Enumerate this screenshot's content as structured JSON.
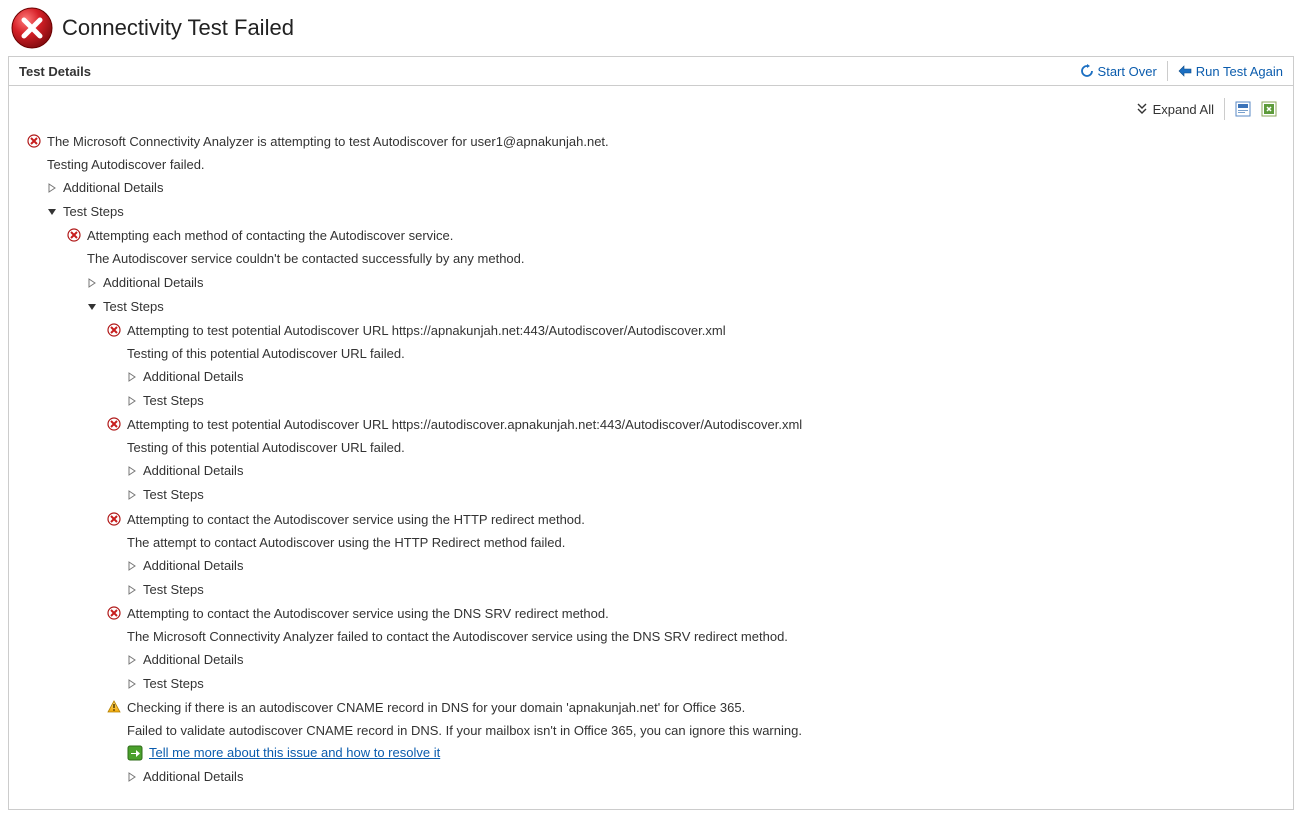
{
  "header": {
    "title": "Connectivity Test Failed"
  },
  "panel": {
    "title": "Test Details",
    "startOver": "Start Over",
    "runAgain": "Run Test Again",
    "expandAll": "Expand All"
  },
  "tree": {
    "root": {
      "title": "The Microsoft Connectivity Analyzer is attempting to test Autodiscover for user1@apnakunjah.net.",
      "sub": "Testing Autodiscover failed.",
      "details": "Additional Details",
      "steps": "Test Steps"
    },
    "methods": {
      "title": "Attempting each method of contacting the Autodiscover service.",
      "sub": "The Autodiscover service couldn't be contacted successfully by any method.",
      "details": "Additional Details",
      "steps": "Test Steps"
    },
    "url1": {
      "title": "Attempting to test potential Autodiscover URL https://apnakunjah.net:443/Autodiscover/Autodiscover.xml",
      "sub": "Testing of this potential Autodiscover URL failed.",
      "details": "Additional Details",
      "steps": "Test Steps"
    },
    "url2": {
      "title": "Attempting to test potential Autodiscover URL https://autodiscover.apnakunjah.net:443/Autodiscover/Autodiscover.xml",
      "sub": "Testing of this potential Autodiscover URL failed.",
      "details": "Additional Details",
      "steps": "Test Steps"
    },
    "http": {
      "title": "Attempting to contact the Autodiscover service using the HTTP redirect method.",
      "sub": "The attempt to contact Autodiscover using the HTTP Redirect method failed.",
      "details": "Additional Details",
      "steps": "Test Steps"
    },
    "dns": {
      "title": "Attempting to contact the Autodiscover service using the DNS SRV redirect method.",
      "sub": "The Microsoft Connectivity Analyzer failed to contact the Autodiscover service using the DNS SRV redirect method.",
      "details": "Additional Details",
      "steps": "Test Steps"
    },
    "cname": {
      "title": "Checking if there is an autodiscover CNAME record in DNS for your domain 'apnakunjah.net' for Office 365.",
      "sub": "Failed to validate autodiscover CNAME record in DNS. If your mailbox isn't in Office 365, you can ignore this warning.",
      "link": "Tell me more about this issue and how to resolve it",
      "details": "Additional Details"
    }
  }
}
